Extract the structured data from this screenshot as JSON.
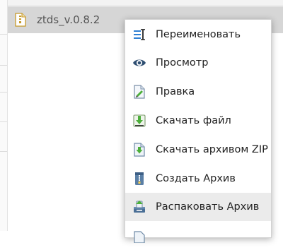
{
  "file": {
    "name": "ztds_v.0.8.2",
    "icon": "archive-file-icon"
  },
  "context_menu": {
    "items": [
      {
        "label": "Переименовать",
        "icon": "rename-icon"
      },
      {
        "label": "Просмотр",
        "icon": "eye-icon"
      },
      {
        "label": "Правка",
        "icon": "edit-file-icon"
      },
      {
        "label": "Скачать файл",
        "icon": "download-icon"
      },
      {
        "label": "Скачать архивом ZIP",
        "icon": "download-zip-icon"
      },
      {
        "label": "Создать Архив",
        "icon": "archive-icon"
      },
      {
        "label": "Распаковать Архив",
        "icon": "extract-archive-icon"
      }
    ],
    "highlighted": "Распаковать Архив"
  },
  "colors": {
    "selected_row": "#d6d6d6",
    "hover_item": "#ebebeb",
    "accent_blue": "#2d7fd3",
    "accent_green": "#4caf3a"
  }
}
